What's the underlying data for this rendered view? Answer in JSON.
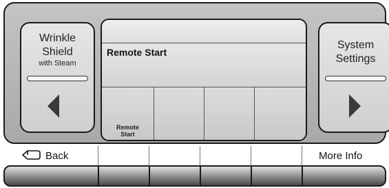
{
  "panel": {
    "left_button": {
      "line1": "Wrinkle",
      "line2": "Shield",
      "line3": "with Steam",
      "arrow": "arrow-left-icon"
    },
    "right_button": {
      "line1": "System",
      "line2": "Settings",
      "arrow": "arrow-right-icon"
    },
    "screen": {
      "title": "Remote Start",
      "softkeys": [
        {
          "line1": "Remote",
          "line2": "Start"
        },
        {
          "line1": "",
          "line2": ""
        },
        {
          "line1": "",
          "line2": ""
        },
        {
          "line1": "",
          "line2": ""
        }
      ]
    }
  },
  "bottom": {
    "back_label": "Back",
    "back_icon": "back-arrow-icon",
    "more_info_label": "More Info"
  }
}
